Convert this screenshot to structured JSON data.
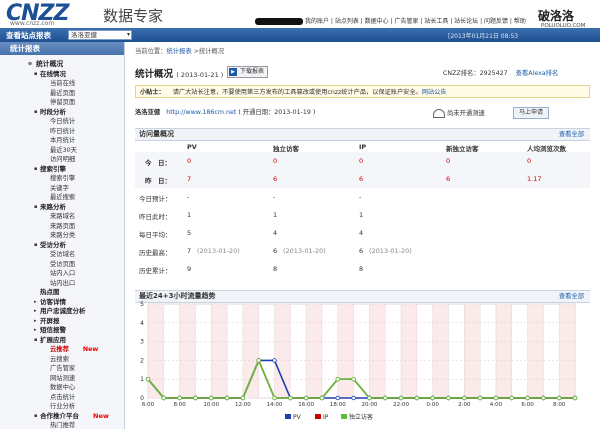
{
  "header": {
    "logo": "CNZZ",
    "logo_sub": "www.cnzz.com",
    "logo_title": "数据专家",
    "top_links": "我的账户 | 站点列表 | 数据中心 | 广告管家 | 站长工具 | 站长论坛 | 问题反馈 | 帮助",
    "watermark": "破洛洛",
    "watermark_url": "POLUOLUO.COM"
  },
  "nav": {
    "label": "查看站点报表",
    "site_select": "洛洛亚健",
    "datetime": "[2013年01月21日 08:53"
  },
  "sidebar": {
    "header": "统计报表",
    "items": [
      {
        "level": 0,
        "label": "统计概况",
        "toggle": "⊖"
      },
      {
        "level": 1,
        "label": "在线情况",
        "toggle": "▪"
      },
      {
        "level": 2,
        "label": "当前在线"
      },
      {
        "level": 2,
        "label": "最近页面"
      },
      {
        "level": 2,
        "label": "停留页面"
      },
      {
        "level": 1,
        "label": "时段分析",
        "toggle": "▪"
      },
      {
        "level": 2,
        "label": "今日统计"
      },
      {
        "level": 2,
        "label": "昨日统计"
      },
      {
        "level": 2,
        "label": "本月统计"
      },
      {
        "level": 2,
        "label": "最近30天"
      },
      {
        "level": 2,
        "label": "访问明细"
      },
      {
        "level": 1,
        "label": "搜索引擎",
        "toggle": "▪"
      },
      {
        "level": 2,
        "label": "搜索引擎"
      },
      {
        "level": 2,
        "label": "关键字"
      },
      {
        "level": 2,
        "label": "最近搜索"
      },
      {
        "level": 1,
        "label": "来路分析",
        "toggle": "▪"
      },
      {
        "level": 2,
        "label": "来路域名"
      },
      {
        "level": 2,
        "label": "来路页面"
      },
      {
        "level": 2,
        "label": "来路分类"
      },
      {
        "level": 1,
        "label": "受访分析",
        "toggle": "▪"
      },
      {
        "level": 2,
        "label": "受访域名"
      },
      {
        "level": 2,
        "label": "受访页面"
      },
      {
        "level": 2,
        "label": "站内入口"
      },
      {
        "level": 2,
        "label": "站内出口"
      },
      {
        "level": 1,
        "label": "热点图",
        "toggle": ""
      },
      {
        "level": 1,
        "label": "访客详情",
        "toggle": "▸"
      },
      {
        "level": 1,
        "label": "用户忠诚度分析",
        "toggle": "▸"
      },
      {
        "level": 1,
        "label": "开屏报",
        "toggle": "▸"
      },
      {
        "level": 1,
        "label": "短信报警",
        "toggle": "▸"
      },
      {
        "level": 1,
        "label": "扩展应用",
        "toggle": "▪"
      },
      {
        "level": 2,
        "label": "云推荐",
        "red": true,
        "badge": "New"
      },
      {
        "level": 2,
        "label": "云搜索"
      },
      {
        "level": 2,
        "label": "广告管家"
      },
      {
        "level": 2,
        "label": "网站测速"
      },
      {
        "level": 2,
        "label": "数据中心"
      },
      {
        "level": 2,
        "label": "点击统计"
      },
      {
        "level": 2,
        "label": "行业分析"
      },
      {
        "level": 1,
        "label": "合作推介平台",
        "toggle": "▪",
        "badge": "New"
      },
      {
        "level": 2,
        "label": "热门推荐"
      }
    ]
  },
  "main": {
    "breadcrumb_prefix": "当前位置：",
    "breadcrumb_link": "统计报表",
    "breadcrumb_rest": " >统计概况",
    "title": "统计概况",
    "title_date": "( 2013-01-21 )",
    "download_label": "下载报表",
    "rank_label": "CNZZ排名：2925427",
    "rank_link": "查看Alexa排名",
    "tip_label": "小贴士：",
    "tip_text": "请广大站长注意，不要使用第三方发布的工具篡改或使用cnzz统计产品，以保证账户安全。",
    "tip_link": "网站公告",
    "site_label": "洛洛亚健",
    "site_url": "http://www.186cm.net",
    "site_open": "( 开通日期：2013-01-19 )",
    "test_label": "尚未开通测速",
    "apply_label": "马上申请",
    "overview_title": "访问量概况",
    "overview_more": "查看全部",
    "columns": [
      "PV",
      "独立访客",
      "IP",
      "新独立访客",
      "人均浏览次数"
    ],
    "rows": [
      {
        "label": "今　日：",
        "pv": "0",
        "uv": "0",
        "ip": "0",
        "nuv": "0",
        "avg": "0",
        "shade": true,
        "red": true
      },
      {
        "label": "昨　日：",
        "pv": "7",
        "uv": "6",
        "ip": "6",
        "nuv": "6",
        "avg": "1.17",
        "shade": true,
        "red": true
      },
      {
        "label": "今日预计：",
        "pv": "-",
        "uv": "-",
        "ip": "-",
        "nuv": "",
        "avg": ""
      },
      {
        "label": "昨日此时：",
        "pv": "1",
        "uv": "1",
        "ip": "1",
        "nuv": "",
        "avg": ""
      },
      {
        "label": "每日平均：",
        "pv": "5",
        "uv": "4",
        "ip": "4",
        "nuv": "",
        "avg": ""
      },
      {
        "label": "历史最高：",
        "pv": "7",
        "pv_date": "(2013-01-20)",
        "uv": "6",
        "uv_date": "(2013-01-20)",
        "ip": "6",
        "ip_date": "(2013-01-20)",
        "nuv": "",
        "avg": ""
      },
      {
        "label": "历史累计：",
        "pv": "9",
        "uv": "8",
        "ip": "8",
        "nuv": "",
        "avg": ""
      }
    ],
    "trend_title": "最近24+3小时流量趋势",
    "trend_more": "查看全部"
  },
  "chart_data": {
    "type": "line",
    "x": [
      "6:00",
      "7:00",
      "8:00",
      "9:00",
      "10:00",
      "11:00",
      "12:00",
      "13:00",
      "14:00",
      "15:00",
      "16:00",
      "17:00",
      "18:00",
      "19:00",
      "20:00",
      "21:00",
      "22:00",
      "23:00",
      "0:00",
      "1:00",
      "2:00",
      "3:00",
      "4:00",
      "5:00",
      "6:00",
      "7:00",
      "8:00",
      "9:00"
    ],
    "x_tick_labels": [
      "6:00",
      "8:00",
      "10:00",
      "12:00",
      "14:00",
      "16:00",
      "18:00",
      "20:00",
      "22:00",
      "0:00",
      "2:00",
      "4:00",
      "6:00",
      "8:00"
    ],
    "ylim": [
      0,
      5
    ],
    "y_ticks": [
      0,
      1,
      2,
      3,
      4,
      5
    ],
    "grid": true,
    "legend": "bottom",
    "series": [
      {
        "name": "PV",
        "color": "#1f3fb0",
        "values": [
          1,
          0,
          0,
          0,
          0,
          0,
          0,
          2,
          2,
          0,
          0,
          0,
          0,
          0,
          0,
          0,
          0,
          0,
          0,
          0,
          0,
          0,
          0,
          0,
          0,
          0,
          0,
          0
        ]
      },
      {
        "name": "IP",
        "color": "#cc0000",
        "values": [
          1,
          0,
          0,
          0,
          0,
          0,
          0,
          2,
          0,
          0,
          0,
          0,
          1,
          1,
          0,
          0,
          0,
          0,
          0,
          0,
          0,
          0,
          0,
          0,
          0,
          0,
          0,
          0
        ]
      },
      {
        "name": "独立访客",
        "color": "#5bbf3b",
        "values": [
          1,
          0,
          0,
          0,
          0,
          0,
          0,
          2,
          0,
          0,
          0,
          0,
          1,
          1,
          0,
          0,
          0,
          0,
          0,
          0,
          0,
          0,
          0,
          0,
          0,
          0,
          0,
          0
        ]
      }
    ]
  }
}
